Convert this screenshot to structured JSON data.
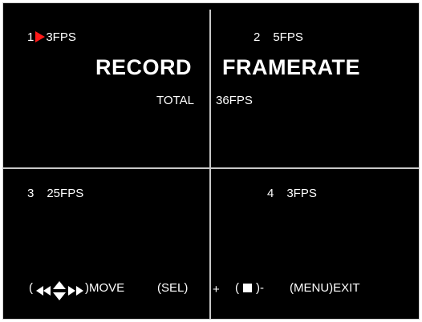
{
  "channels": [
    {
      "number": "1",
      "fps": "3FPS",
      "selected": true
    },
    {
      "number": "2",
      "fps": "5FPS",
      "selected": false
    },
    {
      "number": "3",
      "fps": "25FPS",
      "selected": false
    },
    {
      "number": "4",
      "fps": "3FPS",
      "selected": false
    }
  ],
  "title": {
    "left": "RECORD",
    "right": "FRAMERATE"
  },
  "total": {
    "label": "TOTAL",
    "value": "36FPS"
  },
  "footer": {
    "move_open": "(",
    "move_label": ")MOVE",
    "sel_label": "(SEL)",
    "plus": "+",
    "stop_open": "(",
    "minus_label": ")-",
    "exit_label": "(MENU)EXIT"
  },
  "icons": {
    "cursor": "red-triangle-right-icon",
    "move": "direction-arrows-icon",
    "stop": "stop-square-icon"
  },
  "colors": {
    "background": "#000000",
    "text": "#ffffff",
    "cursor": "#ff1a1a",
    "grid": "#c8c8c8"
  }
}
